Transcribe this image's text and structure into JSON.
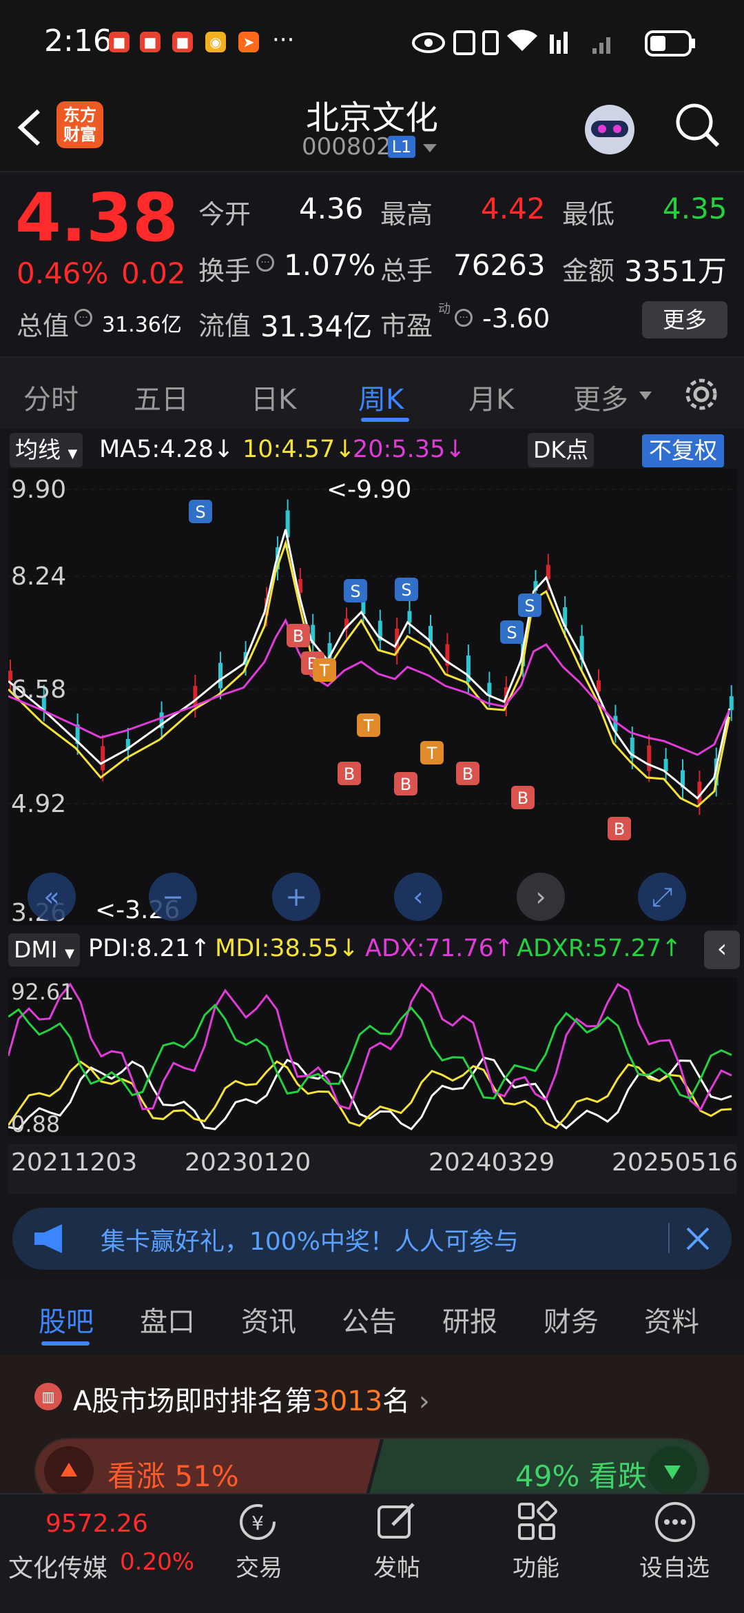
{
  "status": {
    "time": "2:16",
    "more": "···"
  },
  "header": {
    "title": "北京文化",
    "code": "000802",
    "level": "L1",
    "logo_text": "东方财富"
  },
  "quote": {
    "price": "4.38",
    "change_pct": "0.46%",
    "change": "0.02",
    "open_label": "今开",
    "open": "4.36",
    "high_label": "最高",
    "high": "4.42",
    "low_label": "最低",
    "low": "4.35",
    "turnover_label": "换手",
    "turnover": "1.07%",
    "volume_label": "总手",
    "volume": "76263",
    "amount_label": "金额",
    "amount": "3351万",
    "mktcap_label": "总值",
    "mktcap": "31.36亿",
    "float_label": "流值",
    "float": "31.34亿",
    "pe_label": "市盈",
    "pe_sup": "动",
    "pe": "-3.60",
    "more_button": "更多"
  },
  "tabs": [
    "分时",
    "五日",
    "日K",
    "周K",
    "月K",
    "更多"
  ],
  "active_tab": "周K",
  "indicators": {
    "ma_select": "均线",
    "ma5": "MA5:4.28↓",
    "ma10": "10:4.57↓",
    "ma20": "20:5.35↓",
    "dk": "DK点",
    "fq": "不复权",
    "dmi_select": "DMI",
    "pdi": "PDI:8.21↑",
    "mdi": "MDI:38.55↓",
    "adx": "ADX:71.76↑",
    "adxr": "ADXR:57.27↑"
  },
  "chart_data": [
    {
      "type": "candlestick",
      "title": "周K",
      "y_ticks": [
        "9.90",
        "8.24",
        "6.58",
        "4.92",
        "3.26"
      ],
      "ylim": [
        3.26,
        9.9
      ],
      "annotations": [
        "<-9.90",
        "<-3.26"
      ],
      "signal_labels": [
        "S",
        "B",
        "T"
      ],
      "series": [
        {
          "name": "MA5",
          "color": "#ffffff"
        },
        {
          "name": "MA10",
          "color": "#f5e33a"
        },
        {
          "name": "MA20",
          "color": "#e13bd8"
        }
      ]
    },
    {
      "type": "line",
      "title": "DMI",
      "y_ticks": [
        "92.61",
        "0.88"
      ],
      "ylim": [
        0.88,
        92.61
      ],
      "x_ticks": [
        "20211203",
        "20230120",
        "20240329",
        "20250516"
      ],
      "series": [
        {
          "name": "PDI",
          "color": "#ffffff"
        },
        {
          "name": "MDI",
          "color": "#f5e33a"
        },
        {
          "name": "ADX",
          "color": "#e13bd8"
        },
        {
          "name": "ADXR",
          "color": "#25d13e"
        }
      ]
    }
  ],
  "banner": {
    "text": "集卡赢好礼，100%中奖！人人可参与"
  },
  "bottom_tabs": [
    "股吧",
    "盘口",
    "资讯",
    "公告",
    "研报",
    "财务",
    "资料"
  ],
  "ranking": {
    "prefix": "A股市场即时排名第",
    "rank": "3013",
    "suffix": "名"
  },
  "sentiment": {
    "up_label": "看涨 51%",
    "down_label": "49% 看跌"
  },
  "nav": {
    "index_value": "9572.26",
    "index_name": "文化传媒",
    "index_change": "0.20%",
    "trade": "交易",
    "post": "发帖",
    "functions": "功能",
    "watchlist": "设自选"
  }
}
